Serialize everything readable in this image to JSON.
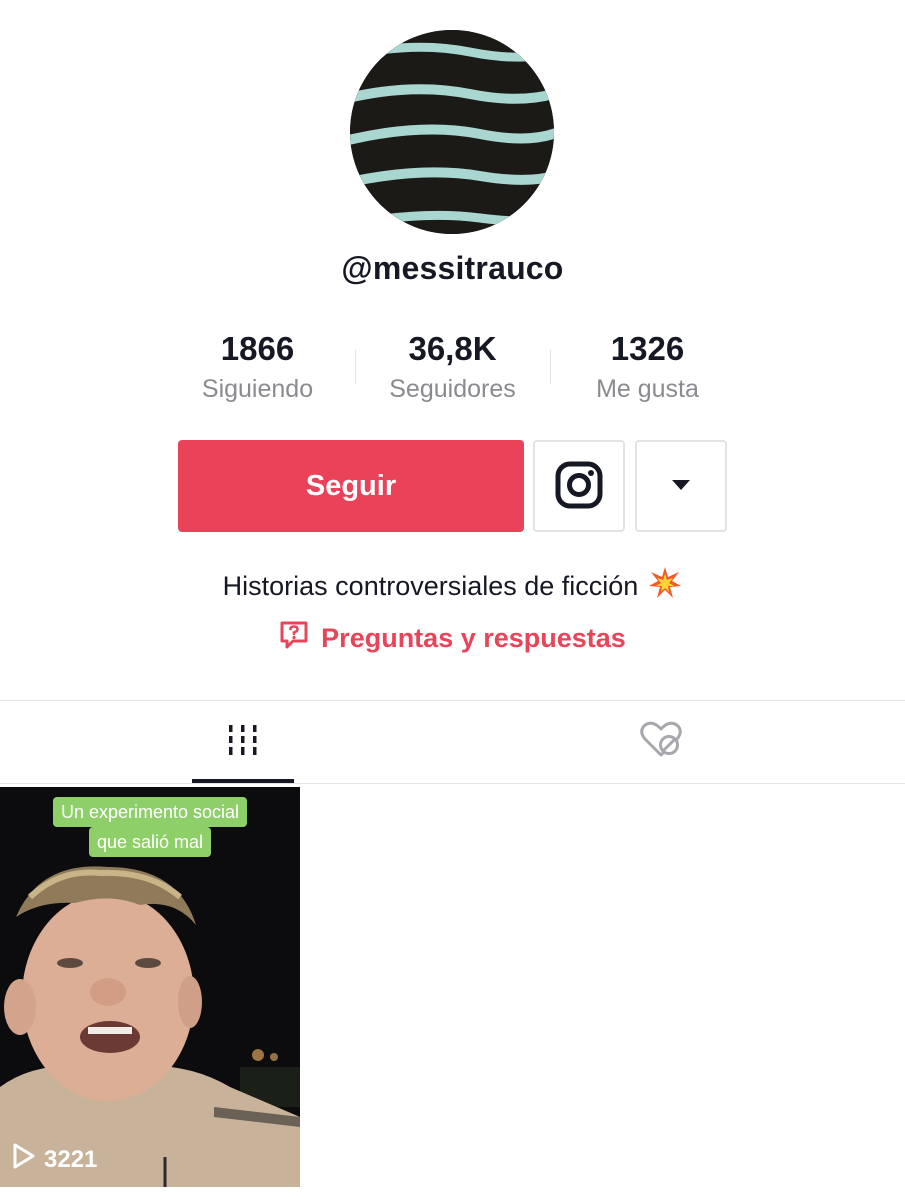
{
  "profile": {
    "username": "@messitrauco",
    "bio": "Historias controversiales de ficción",
    "bio_emoji_icon": "collision-icon"
  },
  "stats": [
    {
      "value": "1866",
      "label": "Siguiendo"
    },
    {
      "value": "36,8K",
      "label": "Seguidores"
    },
    {
      "value": "1326",
      "label": "Me gusta"
    }
  ],
  "actions": {
    "follow_label": "Seguir",
    "instagram_icon": "instagram-icon",
    "more_icon": "caret-down-icon"
  },
  "qa": {
    "label": "Preguntas y respuestas",
    "icon": "question-bubble-icon"
  },
  "tabs": [
    {
      "name": "videos",
      "icon": "grid-icon",
      "selected": true
    },
    {
      "name": "liked",
      "icon": "hidden-heart-icon",
      "selected": false
    }
  ],
  "videos": [
    {
      "caption_lines": [
        "Un experimento social",
        "que salió mal"
      ],
      "play_count": "3221"
    }
  ],
  "colors": {
    "accent": "#ea4359",
    "link": "#e8445a",
    "text": "#161823",
    "secondary_text": "#8a8b91",
    "caption_bg": "#8ecf6a"
  }
}
